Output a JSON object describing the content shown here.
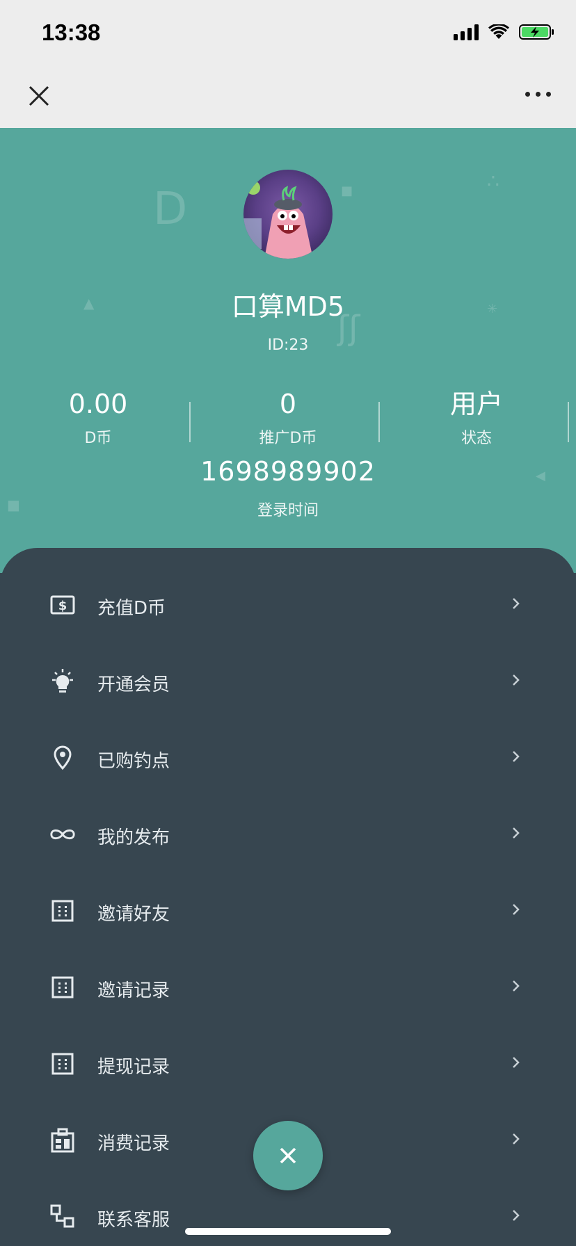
{
  "status_bar": {
    "time": "13:38"
  },
  "profile": {
    "name": "口算MD5",
    "id_text": "ID:23"
  },
  "stats": [
    {
      "value": "0.00",
      "label": "D币"
    },
    {
      "value": "0",
      "label": "推广D币"
    },
    {
      "value": "用户",
      "label": "状态"
    }
  ],
  "login": {
    "value": "1698989902",
    "label": "登录时间"
  },
  "menu": [
    {
      "label": "充值D币",
      "icon": "dollar-bill-icon"
    },
    {
      "label": "开通会员",
      "icon": "lightbulb-icon"
    },
    {
      "label": "已购钓点",
      "icon": "location-pin-icon"
    },
    {
      "label": "我的发布",
      "icon": "infinity-icon"
    },
    {
      "label": "邀请好友",
      "icon": "dotted-grid-icon"
    },
    {
      "label": "邀请记录",
      "icon": "dotted-grid-icon"
    },
    {
      "label": "提现记录",
      "icon": "dotted-grid-icon"
    },
    {
      "label": "消费记录",
      "icon": "building-icon"
    },
    {
      "label": "联系客服",
      "icon": "widgets-icon"
    }
  ],
  "colors": {
    "teal": "#56a79c",
    "panel": "#374650",
    "bar": "#ededed"
  }
}
